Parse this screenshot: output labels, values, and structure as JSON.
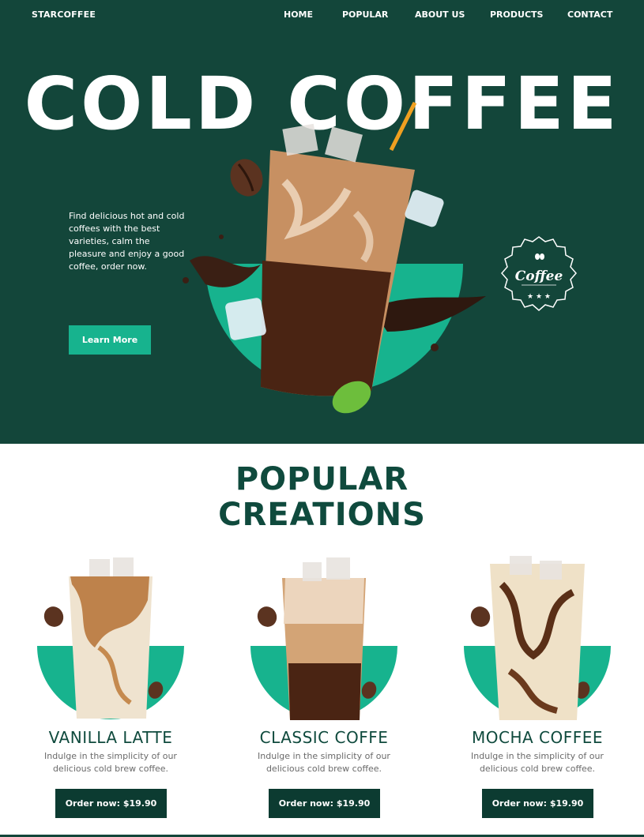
{
  "header": {
    "brand": "STARCOFFEE",
    "nav": [
      "HOME",
      "POPULAR",
      "ABOUT US",
      "PRODUCTS",
      "CONTACT"
    ]
  },
  "hero": {
    "title": "COLD COFFEE",
    "description": "Find delicious hot and cold coffees with the best varieties, calm the pleasure and enjoy a good coffee, order now.",
    "cta_label": "Learn More",
    "badge_text": "Coffee"
  },
  "popular": {
    "title_line1": "POPULAR",
    "title_line2": "CREATIONS",
    "items": [
      {
        "name": "VANILLA LATTE",
        "description": "Indulge in the simplicity of our delicious cold brew coffee.",
        "button": "Order now: $19.90"
      },
      {
        "name": "CLASSIC COFFE",
        "description": "Indulge in the simplicity of our delicious cold brew coffee.",
        "button": "Order now: $19.90"
      },
      {
        "name": "MOCHA COFFEE",
        "description": "Indulge in the simplicity of our delicious cold brew coffee.",
        "button": "Order now: $19.90"
      }
    ]
  },
  "colors": {
    "hero_bg": "#13463a",
    "accent": "#17b38e",
    "dark_green": "#0f4a3d",
    "button_dark": "#0c3b31"
  }
}
